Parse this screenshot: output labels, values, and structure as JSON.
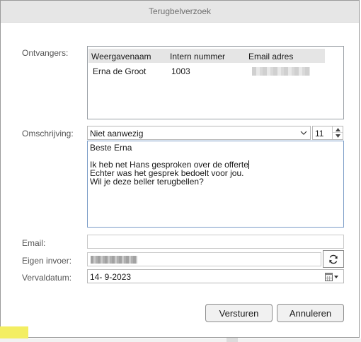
{
  "window": {
    "title": "Terugbelverzoek"
  },
  "labels": {
    "recipients": "Ontvangers:",
    "description": "Omschrijving:",
    "email": "Email:",
    "own_input": "Eigen invoer:",
    "due_date": "Vervaldatum:"
  },
  "recipients_table": {
    "columns": [
      "Weergavenaam",
      "Intern nummer",
      "Email adres"
    ],
    "rows": [
      {
        "name": "Erna de Groot",
        "number": "1003",
        "email": ""
      }
    ]
  },
  "description": {
    "selected": "Niet aanwezig",
    "font_size": "11"
  },
  "message": {
    "lines": [
      "Beste Erna",
      "",
      "Ik heb net Hans gesproken over de offerte",
      "Echter was het gesprek bedoelt voor jou.",
      "Wil je deze beller terugbellen?"
    ]
  },
  "email_value": "",
  "own_input_value": "",
  "due_date_value": "14- 9-2023",
  "buttons": {
    "send": "Versturen",
    "cancel": "Annuleren"
  },
  "icons": {
    "dropdown": "chevron-down-icon",
    "spin_up": "triangle-up-icon",
    "spin_down": "triangle-down-icon",
    "refresh": "refresh-icon",
    "calendar": "calendar-icon"
  },
  "colors": {
    "titlebar": "#e6e6e6",
    "message_border": "#7a9cc7",
    "button_bg": "#f1f1f1"
  }
}
